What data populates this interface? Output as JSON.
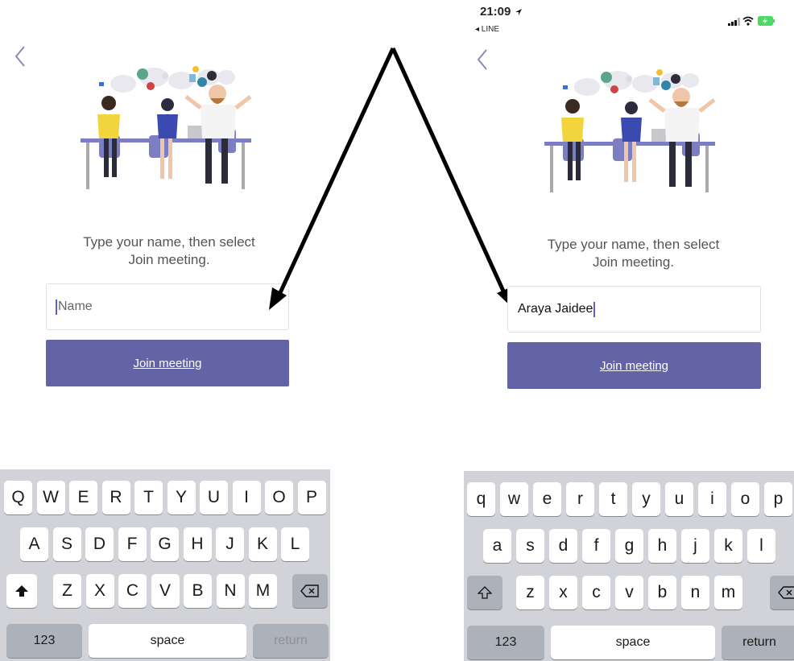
{
  "left": {
    "prompt_line1": "Type your name, then select",
    "prompt_line2": "Join meeting.",
    "name_placeholder": "Name",
    "join_label": "Join meeting",
    "keyboard": {
      "row1": [
        "Q",
        "W",
        "E",
        "R",
        "T",
        "Y",
        "U",
        "I",
        "O",
        "P"
      ],
      "row2": [
        "A",
        "S",
        "D",
        "F",
        "G",
        "H",
        "J",
        "K",
        "L"
      ],
      "row3": [
        "Z",
        "X",
        "C",
        "V",
        "B",
        "N",
        "M"
      ],
      "numbers_label": "123",
      "space_label": "space",
      "return_label": "return"
    }
  },
  "right": {
    "status": {
      "time": "21:09",
      "back_app": "◂ LINE"
    },
    "prompt_line1": "Type your name, then select",
    "prompt_line2": "Join meeting.",
    "name_value": "Araya Jaidee",
    "join_label": "Join meeting",
    "keyboard": {
      "row1": [
        "q",
        "w",
        "e",
        "r",
        "t",
        "y",
        "u",
        "i",
        "o",
        "p"
      ],
      "row2": [
        "a",
        "s",
        "d",
        "f",
        "g",
        "h",
        "j",
        "k",
        "l"
      ],
      "row3": [
        "z",
        "x",
        "c",
        "v",
        "b",
        "n",
        "m"
      ],
      "numbers_label": "123",
      "space_label": "space",
      "return_label": "return"
    }
  },
  "colors": {
    "accent": "#6264a7",
    "keyboard_bg": "#d1d3d9",
    "key_dark": "#acb1ba"
  }
}
